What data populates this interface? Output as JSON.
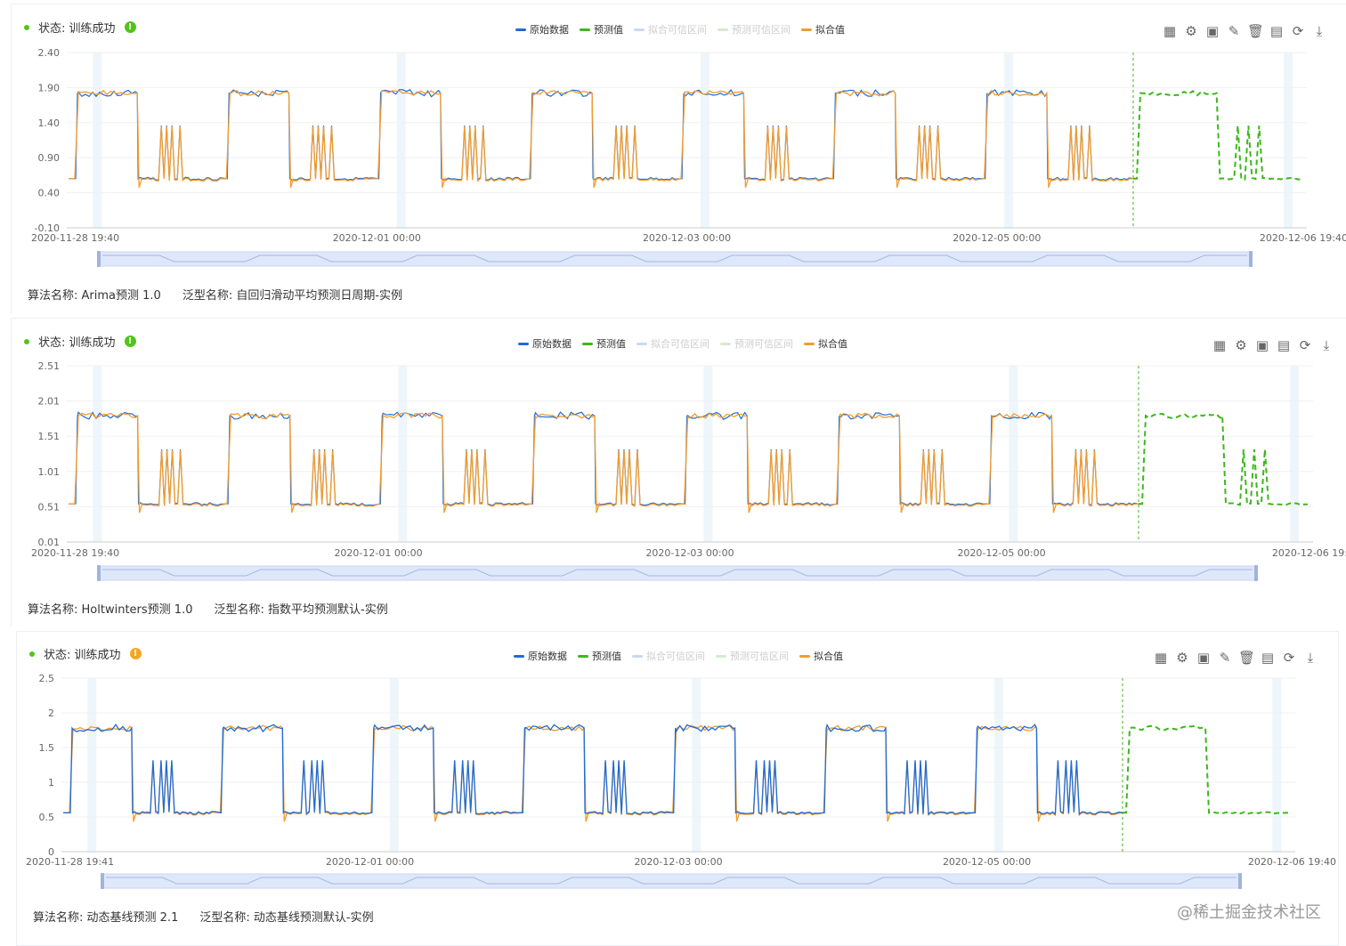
{
  "legend": {
    "items": [
      {
        "label": "原始数据",
        "color": "#1f6bd6",
        "active": true
      },
      {
        "label": "预测值",
        "color": "#3cb81a",
        "active": true
      },
      {
        "label": "拟合可信区间",
        "color": "#c9d9f0",
        "active": false
      },
      {
        "label": "预测可信区间",
        "color": "#d6e9cf",
        "active": false
      },
      {
        "label": "拟合值",
        "color": "#f29c2e",
        "active": true
      }
    ]
  },
  "panels": [
    {
      "status_label": "状态: 训练成功",
      "status_badge": "!",
      "status_badge_color": "#52c41a",
      "algo_label": "算法名称:",
      "algo_value": "Arima预测 1.0",
      "generic_label": "泛型名称:",
      "generic_value": "自回归滑动平均预测日周期-实例",
      "tools": [
        "data-view-icon",
        "settings-icon",
        "save-icon",
        "edit-icon",
        "delete-icon",
        "document-icon",
        "refresh-icon",
        "download-icon"
      ]
    },
    {
      "status_label": "状态: 训练成功",
      "status_badge": "!",
      "status_badge_color": "#52c41a",
      "algo_label": "算法名称:",
      "algo_value": "Holtwinters预测 1.0",
      "generic_label": "泛型名称:",
      "generic_value": "指数平均预测默认-实例",
      "tools": [
        "data-view-icon",
        "settings-icon",
        "save-icon",
        "document-icon",
        "refresh-icon",
        "download-icon"
      ]
    },
    {
      "status_label": "状态: 训练成功",
      "status_badge": "!",
      "status_badge_color": "#f5a623",
      "algo_label": "算法名称:",
      "algo_value": "动态基线预测 2.1",
      "generic_label": "泛型名称:",
      "generic_value": "动态基线预测默认-实例",
      "tools": [
        "data-view-icon",
        "settings-icon",
        "save-icon",
        "edit-icon",
        "delete-icon",
        "document-icon",
        "refresh-icon",
        "download-icon"
      ]
    }
  ],
  "watermark": "@稀土掘金技术社区",
  "chart_data": [
    {
      "type": "line",
      "x_ticks": [
        "2020-11-28 19:40",
        "2020-12-01 00:00",
        "2020-12-03 00:00",
        "2020-12-05 00:00",
        "2020-12-06 19:40"
      ],
      "y_ticks": [
        "2.40",
        "1.90",
        "1.40",
        "0.90",
        "0.40",
        "-0.10"
      ],
      "ylim": [
        -0.1,
        2.4
      ],
      "high": 1.82,
      "low": 0.6,
      "forecast_start_fraction": 0.86,
      "series": [
        {
          "name": "原始数据"
        },
        {
          "name": "预测值"
        },
        {
          "name": "拟合值"
        }
      ]
    },
    {
      "type": "line",
      "x_ticks": [
        "2020-11-28 19:40",
        "2020-12-01 00:00",
        "2020-12-03 00:00",
        "2020-12-05 00:00",
        "2020-12-06 19:4"
      ],
      "y_ticks": [
        "2.51",
        "2.01",
        "1.51",
        "1.01",
        "0.51",
        "0.01"
      ],
      "ylim": [
        0.01,
        2.51
      ],
      "high": 1.8,
      "low": 0.55,
      "forecast_start_fraction": 0.86,
      "series": [
        {
          "name": "原始数据"
        },
        {
          "name": "预测值"
        },
        {
          "name": "拟合值"
        }
      ]
    },
    {
      "type": "line",
      "x_ticks": [
        "2020-11-28 19:41",
        "2020-12-01 00:00",
        "2020-12-03 00:00",
        "2020-12-05 00:00",
        "2020-12-06 19:40"
      ],
      "y_ticks": [
        "2.5",
        "2",
        "1.5",
        "1",
        "0.5",
        "0"
      ],
      "ylim": [
        0,
        2.5
      ],
      "high": 1.78,
      "low": 0.56,
      "forecast_start_fraction": 0.86,
      "series": [
        {
          "name": "原始数据"
        },
        {
          "name": "预测值"
        },
        {
          "name": "拟合值"
        }
      ]
    }
  ]
}
